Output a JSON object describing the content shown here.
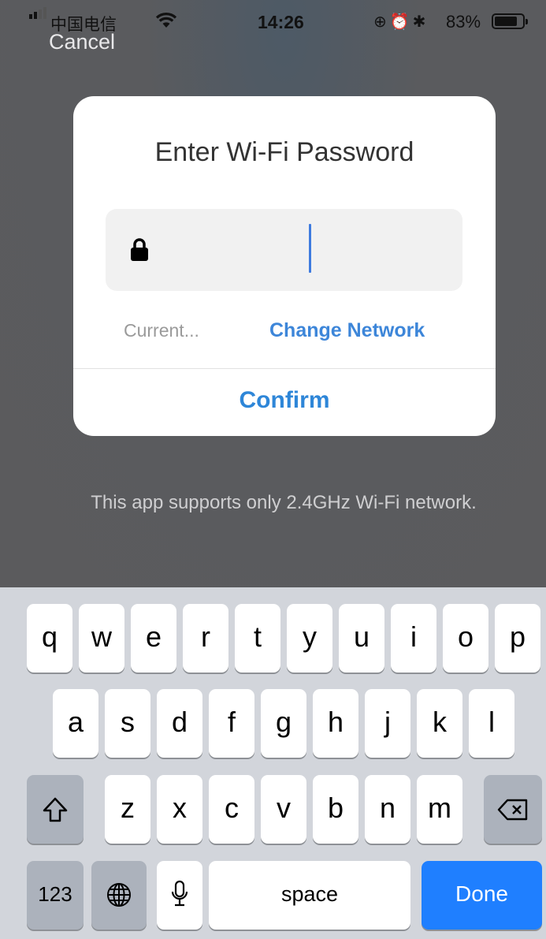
{
  "status_bar": {
    "carrier": "中国电信",
    "time": "14:26",
    "battery": "83%",
    "battery_level": 0.83
  },
  "nav": {
    "cancel_label": "Cancel"
  },
  "dialog": {
    "title": "Enter Wi-Fi Password",
    "password_value": "",
    "current_network": "Current...",
    "change_network_label": "Change Network",
    "confirm_label": "Confirm"
  },
  "note": "This app supports only 2.4GHz Wi-Fi network.",
  "keyboard": {
    "row1": [
      "q",
      "w",
      "e",
      "r",
      "t",
      "y",
      "u",
      "i",
      "o",
      "p"
    ],
    "row2": [
      "a",
      "s",
      "d",
      "f",
      "g",
      "h",
      "j",
      "k",
      "l"
    ],
    "row3": [
      "z",
      "x",
      "c",
      "v",
      "b",
      "n",
      "m"
    ],
    "numbers_label": "123",
    "space_label": "space",
    "done_label": "Done"
  },
  "icons": [
    "signal-icon",
    "wifi-icon",
    "rotation-lock-icon",
    "alarm-icon",
    "bluetooth-icon",
    "battery-icon",
    "lock-icon",
    "shift-icon",
    "delete-icon",
    "globe-icon",
    "microphone-icon"
  ],
  "colors": {
    "accent": "#3d86d9",
    "done_key": "#1f7fff",
    "caret": "#3e7bdf"
  }
}
